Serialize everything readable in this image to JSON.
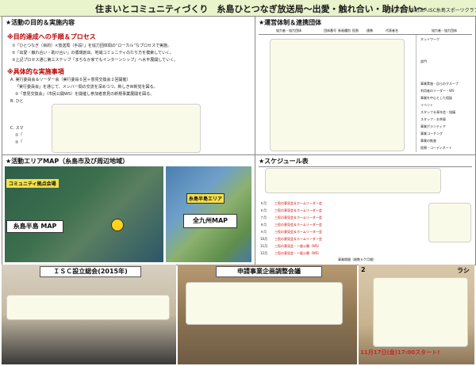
{
  "title": "住まいとコミュニティづくり　糸島ひとつなぎ放送局〜出愛・触れ合い・助け合い〜",
  "organization": "特定非営利活動法人ISC糸島スポーツクラブ",
  "purpose": {
    "header": "★活動の目的＆実施内容",
    "subheader": "※目的達成への手順＆プロセス",
    "lines": [
      "①「ひとつなぎ（目的）×放送局（手段）」を協力団体間の“ローカル”なプロセスで実施。",
      "②「出愛・触れ合い・助け合い」の循環創出、地域コミュニティのたり方を模索していく。",
      "③上記プロセス通じ第三ステップ「まちなか家でもインターンシップ」へ水平展開していく。"
    ],
    "sub2": "※具体的な実施事項",
    "items": [
      "A. 実行委員会＆リーダー会（実行委員６回＋意見交換会２回開催）",
      "「実行委員会」を通じて、メンバー間の交流を深めつつ、新しきW新覚を図る。",
      "②「意見交換会」（市民公開WS）を開催し参加者意見の新規事業展開を図る。",
      "B. ひと",
      "C. スマ",
      "①「",
      "②「"
    ]
  },
  "management": {
    "header": "★運営体制＆連携団体",
    "table_labels": [
      "協力者・協力団体",
      "団体番号",
      "参画種別",
      "役割",
      "連携",
      "代表者名",
      "協力者・協力団体"
    ],
    "right_rows": [
      "",
      "ネットワーク",
      "",
      "",
      "部門",
      "",
      "",
      "事業実施・自らのグループ",
      "利用者のリーダー・WS",
      "事業を中心とした相談",
      "イベント",
      "スタッフ＆青年会・協議",
      "スタッフ・お茶屋",
      "事業ボランティア",
      "事業コーチング",
      "事業の推進",
      "医療・コーディネート",
      "地域支援会(インターンシップ)",
      "事業者・教育・市内事業関係",
      "社福スポーツクラブ施設"
    ]
  },
  "area_map": {
    "header": "★活動エリアMAP（糸島市及び周辺地域）",
    "map_left_tag": "コミュニティ拠点会場",
    "map_left_label": "糸島半島 MAP",
    "map_right_tag": "糸島半島エリア",
    "map_right_label": "全九州MAP"
  },
  "schedule": {
    "header": "★スケジュール表",
    "items": [
      "５月",
      "６月",
      "７月",
      "８月",
      "９月",
      "10月",
      "11月",
      "12月",
      "１月",
      "２月"
    ],
    "bars": [
      "三役の意見会＆ホームリーダー会",
      "三役の意見会＆ホームリーダー会",
      "三役の意見会＆ホームリーダー会",
      "三役の意見会＆ホームリーダー会",
      "三役の意見会＆ホームリーダー会",
      "三役の意見会＆ホームリーダー会",
      "三役の意見会・一般公開（WS）",
      "三役の意見会・一般公開（WS）"
    ],
    "footer": "事業期間（総数６ケ月間）"
  },
  "photos": {
    "caption1": "ＩＳＣ設立総会(2015年)",
    "caption2": "申請事業企画調整会議",
    "caption3_partial": "2",
    "caption3_right": "ラシ",
    "date_banner": "11月17日(金)17:00スタート!"
  }
}
